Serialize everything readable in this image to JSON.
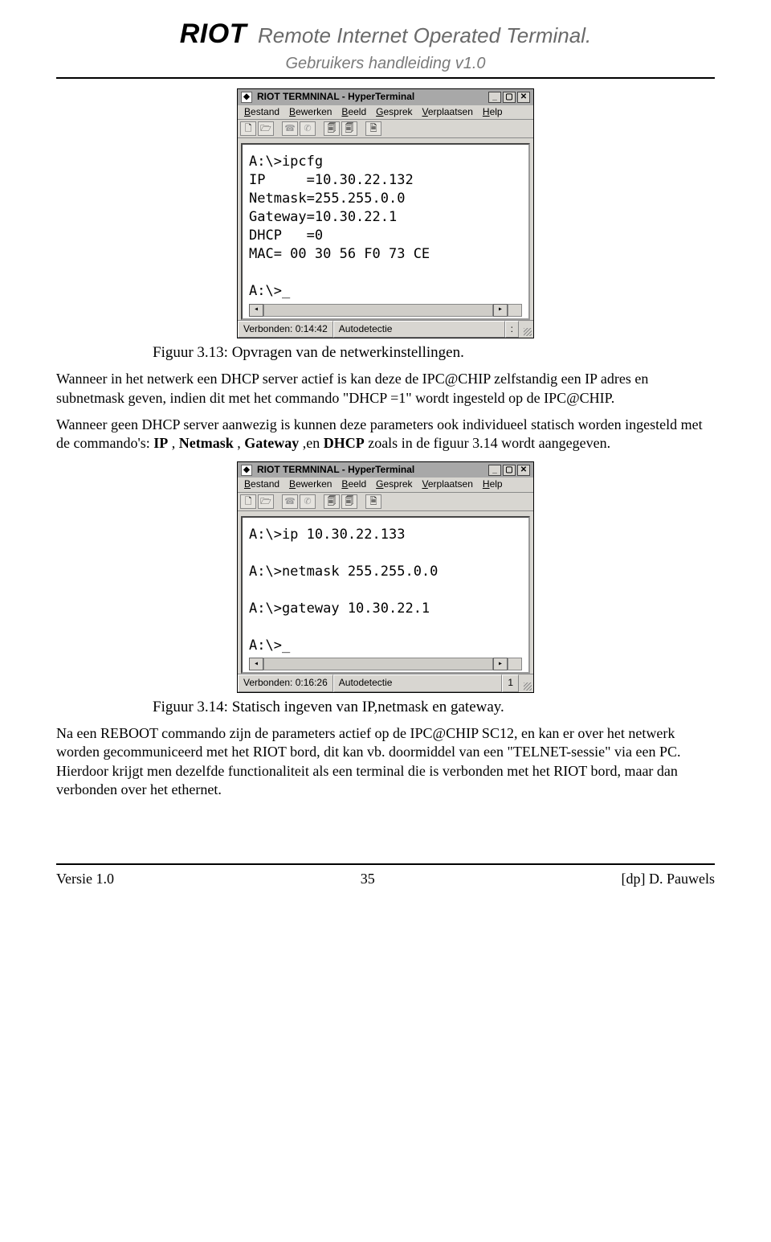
{
  "header": {
    "riot": "RIOT",
    "title": "Remote Internet Operated Terminal.",
    "subtitle": "Gebruikers handleiding v1.0"
  },
  "window": {
    "title": "RIOT TERMNINAL - HyperTerminal",
    "menu": {
      "m1": "Bestand",
      "m2": "Bewerken",
      "m3": "Beeld",
      "m4": "Gesprek",
      "m5": "Verplaatsen",
      "m6": "Help"
    },
    "ctrl": {
      "min": "_",
      "max": "▢",
      "close": "✕"
    }
  },
  "term1": {
    "lines": "A:\\>ipcfg\nIP     =10.30.22.132\nNetmask=255.255.0.0\nGateway=10.30.22.1\nDHCP   =0\nMAC= 00 30 56 F0 73 CE\n\nA:\\>_",
    "status_conn": "Verbonden: 0:14:42",
    "status_auto": "Autodetectie",
    "status_extra": ":"
  },
  "term2": {
    "lines": "A:\\>ip 10.30.22.133\n\nA:\\>netmask 255.255.0.0\n\nA:\\>gateway 10.30.22.1\n\nA:\\>_",
    "status_conn": "Verbonden: 0:16:26",
    "status_auto": "Autodetectie",
    "status_extra": "1"
  },
  "caption1": "Figuur 3.13: Opvragen van de netwerkinstellingen.",
  "para1a": "Wanneer in het netwerk een DHCP server actief is kan deze de IPC@CHIP zelfstandig een IP adres en subnetmask geven, indien dit met het commando \"DHCP =1\" wordt ingesteld op de IPC@CHIP.",
  "para1b_a": "Wanneer geen DHCP server aanwezig is kunnen deze parameters ook individueel statisch worden ingesteld met  de commando's: ",
  "cmds": {
    "ip": "IP",
    "nm": "Netmask",
    "gw": "Gateway",
    "dhcp": "DHCP"
  },
  "para1b_b": "zoals in de figuur 3.14 wordt aangegeven.",
  "caption2": "Figuur 3.14: Statisch ingeven van IP,netmask en gateway.",
  "para2": "Na een REBOOT commando zijn de parameters actief op de IPC@CHIP SC12, en kan er over het netwerk worden gecommuniceerd met het RIOT bord, dit kan vb. doormiddel van een \"TELNET-sessie\" via een PC. Hierdoor krijgt men dezelfde functionaliteit als een terminal die is verbonden met het RIOT bord, maar dan verbonden over het ethernet.",
  "footer": {
    "left": "Versie 1.0",
    "page": "35",
    "right": "[dp] D. Pauwels"
  }
}
